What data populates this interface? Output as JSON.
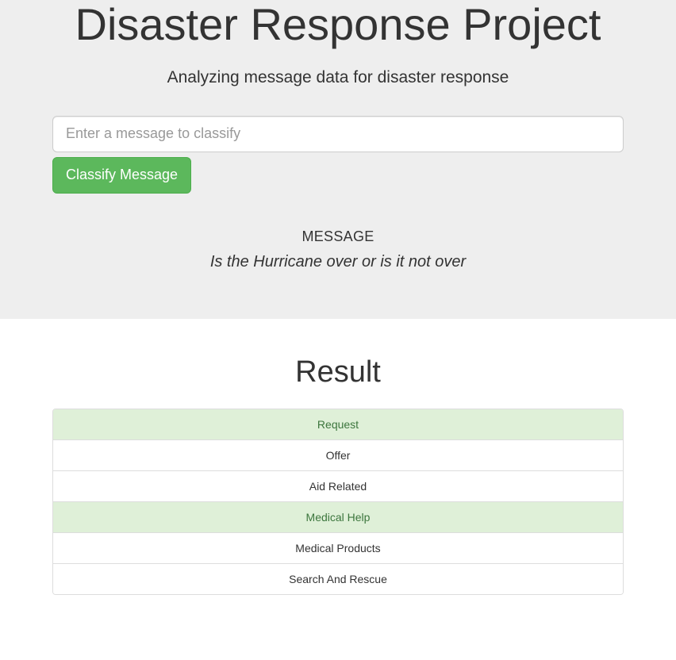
{
  "header": {
    "title": "Disaster Response Project",
    "subtitle": "Analyzing message data for disaster response"
  },
  "form": {
    "placeholder": "Enter a message to classify",
    "value": "",
    "button_label": "Classify Message"
  },
  "message": {
    "label": "MESSAGE",
    "text": "Is the Hurricane over or is it not over"
  },
  "result": {
    "title": "Result",
    "items": [
      {
        "label": "Request",
        "highlight": true
      },
      {
        "label": "Offer",
        "highlight": false
      },
      {
        "label": "Aid Related",
        "highlight": false
      },
      {
        "label": "Medical Help",
        "highlight": true
      },
      {
        "label": "Medical Products",
        "highlight": false
      },
      {
        "label": "Search And Rescue",
        "highlight": false
      }
    ]
  }
}
